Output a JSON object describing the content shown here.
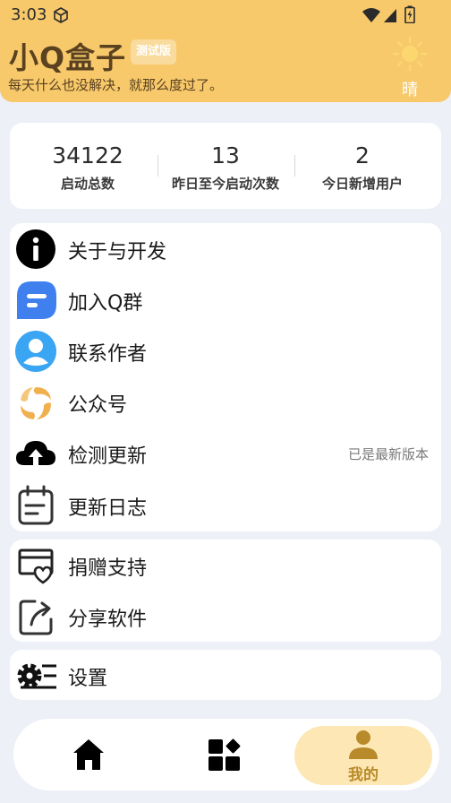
{
  "status_bar": {
    "time": "3:03"
  },
  "header": {
    "title": "小Q盒子",
    "badge": "测试版",
    "subtitle": "每天什么也没解决，就那么度过了。",
    "weather": "晴"
  },
  "stats": [
    {
      "value": "34122",
      "label": "启动总数"
    },
    {
      "value": "13",
      "label": "昨日至今启动次数"
    },
    {
      "value": "2",
      "label": "今日新增用户"
    }
  ],
  "menu_group_1": [
    {
      "label": "关于与开发",
      "icon": "info-icon"
    },
    {
      "label": "加入Q群",
      "icon": "chat-bubble-icon"
    },
    {
      "label": "联系作者",
      "icon": "user-icon"
    },
    {
      "label": "公众号",
      "icon": "swirl-logo-icon"
    },
    {
      "label": "检测更新",
      "icon": "cloud-upload-icon",
      "status": "已是最新版本"
    },
    {
      "label": "更新日志",
      "icon": "calendar-log-icon"
    }
  ],
  "menu_group_2": [
    {
      "label": "捐赠支持",
      "icon": "donate-icon"
    },
    {
      "label": "分享软件",
      "icon": "share-icon"
    }
  ],
  "menu_group_3": [
    {
      "label": "设置",
      "icon": "settings-icon"
    }
  ],
  "bottom_nav": {
    "home_icon": "home-icon",
    "apps_icon": "apps-icon",
    "mine_label": "我的",
    "active": "mine"
  },
  "colors": {
    "header_bg": "#f7c96b",
    "page_bg": "#eef0f8",
    "accent": "#b88a2a",
    "nav_active_bg": "#fde7b4"
  }
}
